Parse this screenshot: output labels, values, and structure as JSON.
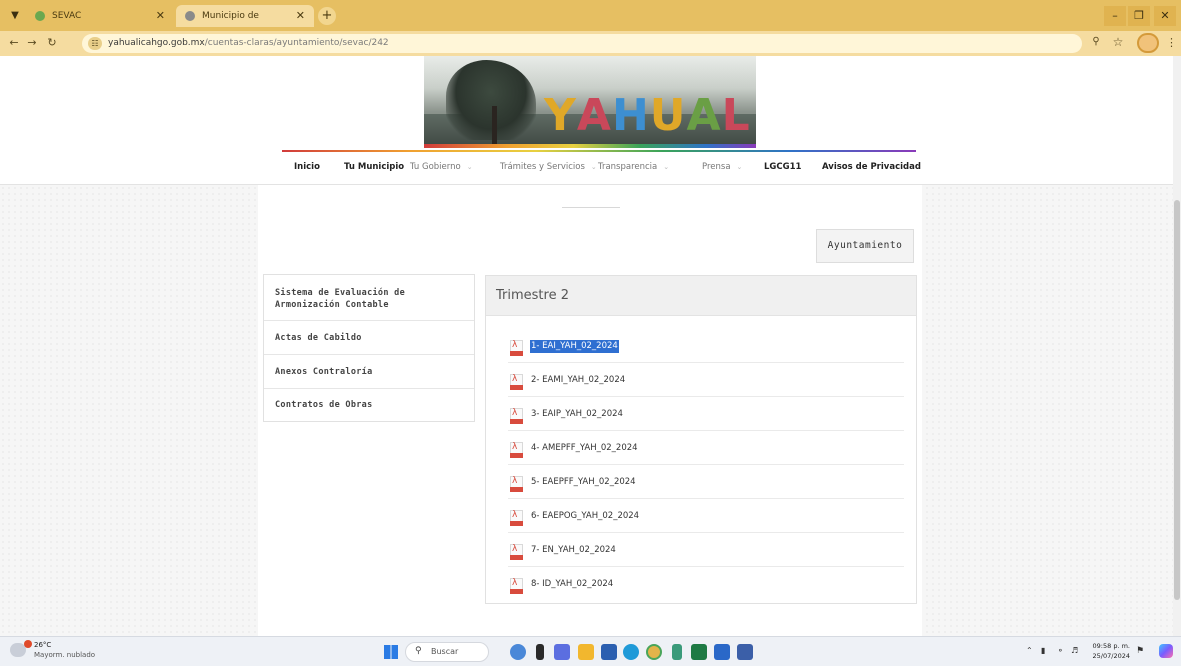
{
  "browser": {
    "tabs": [
      {
        "label": "SEVAC",
        "active": false
      },
      {
        "label": "Municipio de Yahualicango",
        "active": true
      }
    ],
    "new_tab_label": "+",
    "url_host": "yahualicahgo.gob.mx",
    "url_path": "/cuentas-claras/ayuntamiento/sevac/242"
  },
  "site": {
    "banner_text": "YAHUALICA",
    "nav": [
      {
        "label": "Inicio",
        "style": "bold",
        "caret": false
      },
      {
        "label": "Tu Municipio",
        "style": "bold",
        "caret": false
      },
      {
        "label": "Tu Gobierno",
        "style": "light",
        "caret": true
      },
      {
        "label": "Trámites y Servicios",
        "style": "light",
        "caret": true
      },
      {
        "label": "Transparencia",
        "style": "light",
        "caret": true
      },
      {
        "label": "Prensa",
        "style": "light",
        "caret": true
      },
      {
        "label": "LGCG11",
        "style": "bold",
        "caret": false
      },
      {
        "label": "Avisos de Privacidad",
        "style": "bold",
        "caret": false
      }
    ]
  },
  "main": {
    "ayuntamiento_button": "Ayuntamiento",
    "sidebar": [
      {
        "label": "Sistema de Evaluación de Armonización Contable"
      },
      {
        "label": "Actas de Cabildo"
      },
      {
        "label": "Anexos Contraloría"
      },
      {
        "label": "Contratos de Obras"
      }
    ],
    "panel_title": "Trimestre 2",
    "files": [
      {
        "name": "1- EAI_YAH_02_2024",
        "selected": true
      },
      {
        "name": "2- EAMI_YAH_02_2024",
        "selected": false
      },
      {
        "name": "3- EAIP_YAH_02_2024",
        "selected": false
      },
      {
        "name": "4- AMEPFF_YAH_02_2024",
        "selected": false
      },
      {
        "name": "5- EAEPFF_YAH_02_2024",
        "selected": false
      },
      {
        "name": "6- EAEPOG_YAH_02_2024",
        "selected": false
      },
      {
        "name": "7- EN_YAH_02_2024",
        "selected": false
      },
      {
        "name": "8- ID_YAH_02_2024",
        "selected": false
      }
    ]
  },
  "taskbar": {
    "weather_temp": "26°C",
    "weather_desc": "Mayorm. nublado",
    "search_label": "Buscar",
    "time": "09:58 p. m.",
    "date": "25/07/2024",
    "colors": {
      "accent": "#2a7be4",
      "selection": "#2f6fd1",
      "pdf": "#d84b3d"
    }
  }
}
